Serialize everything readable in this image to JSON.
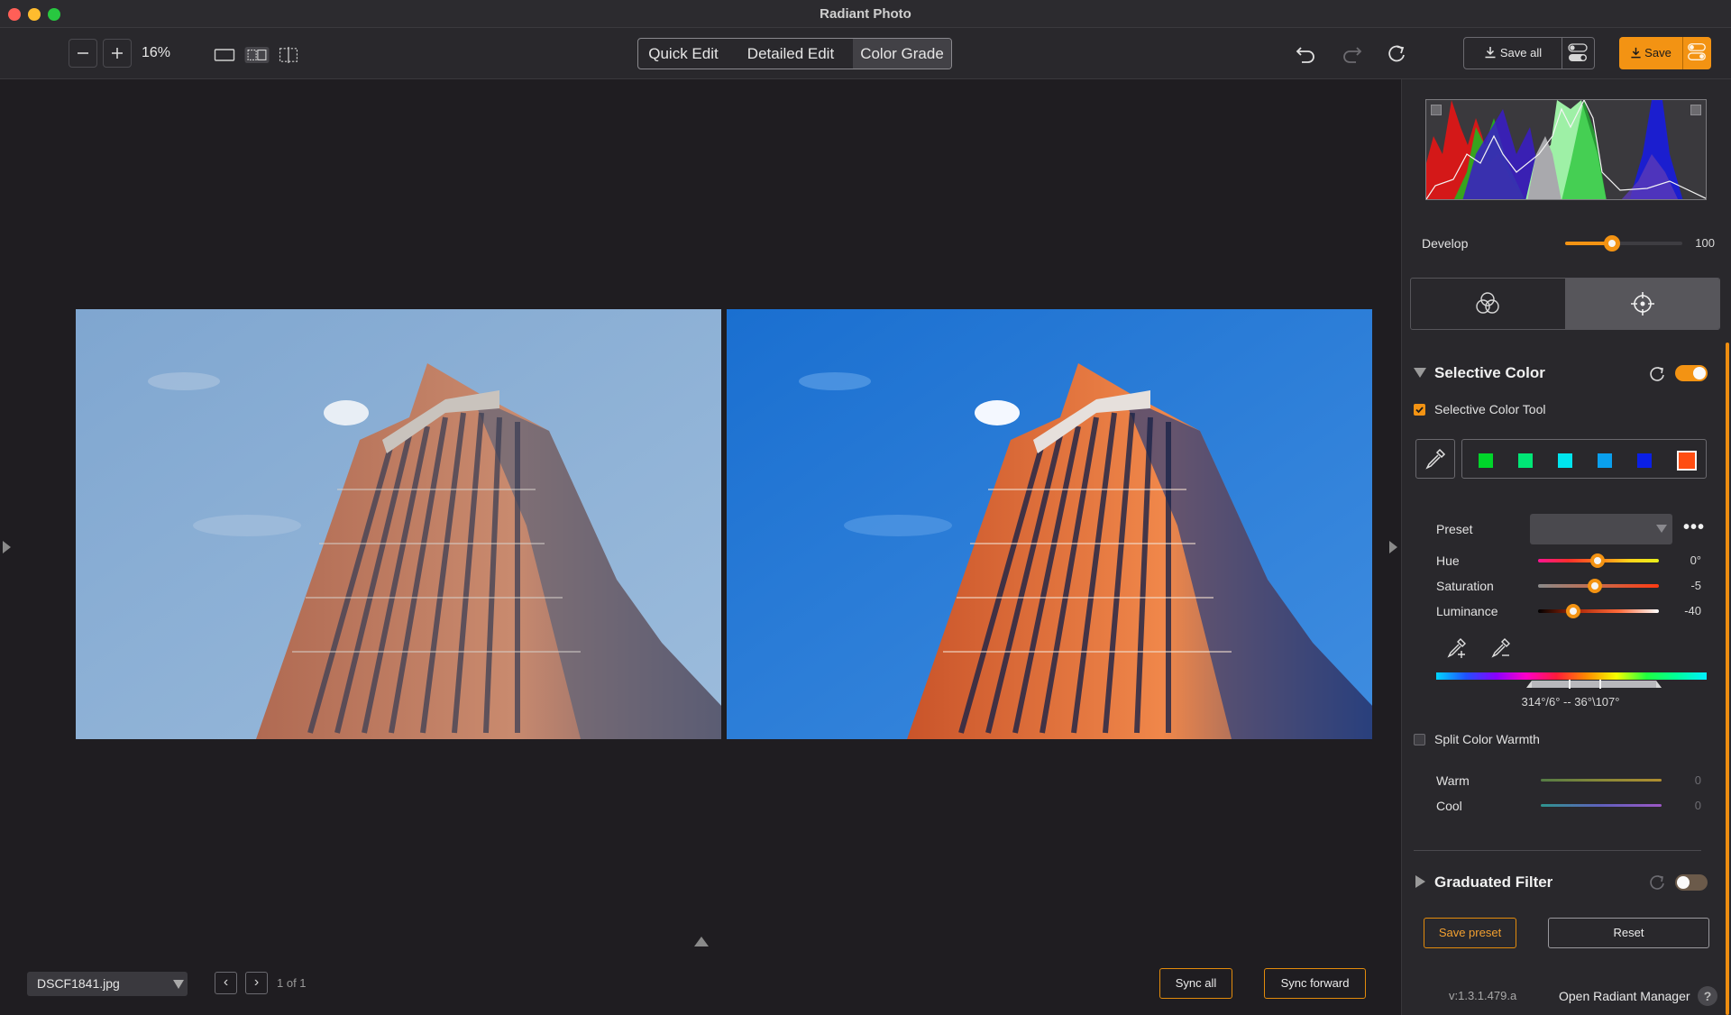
{
  "app": {
    "title": "Radiant Photo"
  },
  "toolbar": {
    "zoom_out_icon": "minus-icon",
    "zoom_in_icon": "plus-icon",
    "zoom": "16%",
    "modes": [
      "Quick Edit",
      "Detailed Edit",
      "Color Grade"
    ],
    "active_mode": "Color Grade",
    "save_all_label": "Save all",
    "save_label": "Save"
  },
  "canvas": {
    "before_image": "photo of a tall brick skyscraper against a light blue sky (original)",
    "after_image": "photo of a tall brick skyscraper against a deep blue sky (edited)"
  },
  "bottom": {
    "filename": "DSCF1841.jpg",
    "prev_icon": "chevron-left-icon",
    "next_icon": "chevron-right-icon",
    "page_count": "1 of 1",
    "sync_all_label": "Sync all",
    "sync_forward_label": "Sync forward"
  },
  "panel": {
    "develop_label": "Develop",
    "develop_value": "100",
    "develop_level": 1.0,
    "selective_color": {
      "title": "Selective Color",
      "enabled": true,
      "tool_label": "Selective Color Tool",
      "tool_checked": true,
      "swatches": [
        "#00d52a",
        "#00e676",
        "#00e5ee",
        "#0aa0ee",
        "#0a1fe6",
        "#ff4d12"
      ],
      "selected_swatch": 5,
      "preset_label": "Preset",
      "preset_value": "",
      "hue_label": "Hue",
      "hue_value": "0°",
      "saturation_label": "Saturation",
      "saturation_value": "-5",
      "luminance_label": "Luminance",
      "luminance_value": "-40",
      "range_readout": "314°/6° -- 36°\\107°"
    },
    "split_warmth": {
      "label": "Split Color Warmth",
      "checked": false,
      "warm_label": "Warm",
      "warm_value": "0",
      "cool_label": "Cool",
      "cool_value": "0"
    },
    "graduated_filter": {
      "title": "Graduated Filter",
      "enabled": false
    },
    "save_preset_label": "Save preset",
    "reset_label": "Reset",
    "version": "v:1.3.1.479.a",
    "open_manager_label": "Open Radiant Manager",
    "help_label": "?"
  },
  "colors": {
    "accent": "#f39313",
    "background": "#1f1d21",
    "panel": "#29282c"
  }
}
